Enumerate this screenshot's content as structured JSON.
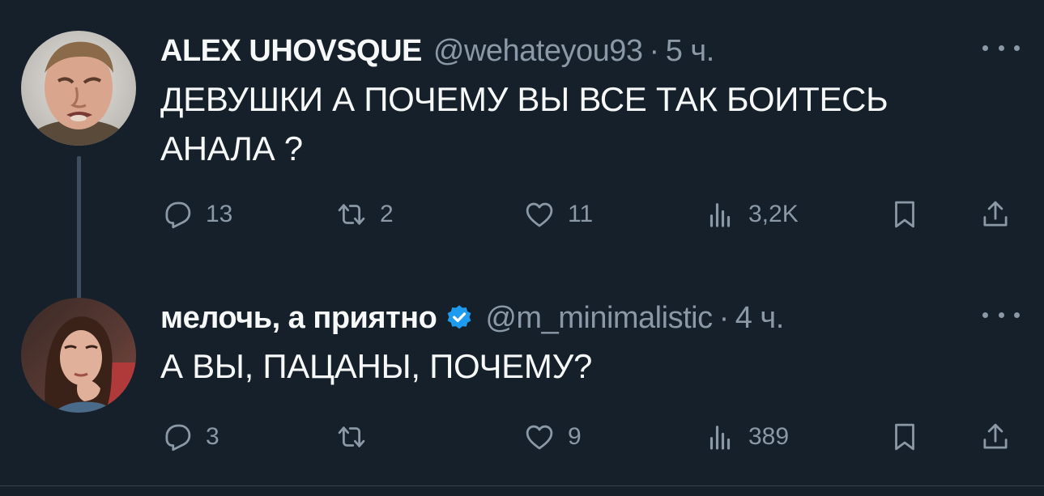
{
  "tweets": [
    {
      "author_name": "ALEX UHOVSQUE",
      "handle": "@wehateyou93",
      "separator": "·",
      "time": "5 ч.",
      "verified": false,
      "text_lines": [
        "ДЕВУШКИ А ПОЧЕМУ ВЫ ВСЕ ТАК БОИТЕСЬ",
        "АНАЛА ?"
      ],
      "replies": "13",
      "retweets": "2",
      "likes": "11",
      "views": "3,2K"
    },
    {
      "author_name": "мелочь, а приятно",
      "handle": "@m_minimalistic",
      "separator": "·",
      "time": "4 ч.",
      "verified": true,
      "text_lines": [
        "А ВЫ, ПАЦАНЫ, ПОЧЕМУ?"
      ],
      "replies": "3",
      "retweets": "",
      "likes": "9",
      "views": "389"
    }
  ],
  "icons": {
    "reply": "reply-icon",
    "retweet": "retweet-icon",
    "like": "heart-icon",
    "views": "views-icon",
    "bookmark": "bookmark-icon",
    "share": "share-icon",
    "more": "more-icon",
    "verified": "verified-badge-icon"
  },
  "colors": {
    "background": "#15202b",
    "text": "#f7f9f9",
    "muted": "#8b98a5",
    "verified": "#1d9bf0",
    "thread_line": "#3d4f5e"
  }
}
